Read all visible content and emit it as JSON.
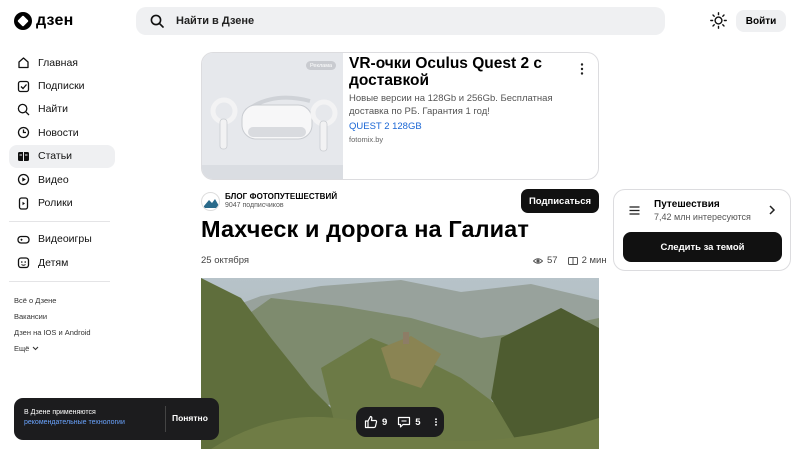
{
  "header": {
    "logo_text": "дзен",
    "search_placeholder": "Найти в Дзене",
    "login_label": "Войти"
  },
  "sidebar": {
    "items": [
      {
        "label": "Главная",
        "icon": "home-icon",
        "active": false
      },
      {
        "label": "Подписки",
        "icon": "subscriptions-icon",
        "active": false
      },
      {
        "label": "Найти",
        "icon": "search-icon",
        "active": false
      },
      {
        "label": "Новости",
        "icon": "news-icon",
        "active": false
      },
      {
        "label": "Статьи",
        "icon": "articles-icon",
        "active": true
      },
      {
        "label": "Видео",
        "icon": "video-icon",
        "active": false
      },
      {
        "label": "Ролики",
        "icon": "shorts-icon",
        "active": false
      }
    ],
    "items2": [
      {
        "label": "Видеоигры",
        "icon": "gamepad-icon"
      },
      {
        "label": "Детям",
        "icon": "kids-icon"
      }
    ],
    "footer_links": [
      "Всё о Дзене",
      "Вакансии",
      "Дзен на IOS и Android",
      "Ещё"
    ]
  },
  "ad": {
    "badge": "Реклама",
    "title": "VR-очки Oculus Quest 2 с доставкой",
    "text": "Новые версии на 128Gb и 256Gb. Бесплатная доставка по РБ. Гарантия 1 год!",
    "link": "QUEST 2 128GB",
    "domain": "fotomix.by"
  },
  "channel": {
    "name": "БЛОГ ФОТОПУТЕШЕСТВИЙ",
    "subscribers": "9047 подписчиков",
    "subscribe_label": "Подписаться"
  },
  "article": {
    "title": "Махческ и дорога на Галиат",
    "date": "25 октября",
    "views": "57",
    "read_time": "2 мин"
  },
  "topic": {
    "name": "Путешествия",
    "interested": "7,42 млн интересуются",
    "follow_label": "Следить за темой"
  },
  "toast": {
    "line1": "В Дзене применяются",
    "line2": "рекомендательные технологии",
    "ok_label": "Понятно"
  },
  "reactions": {
    "likes": "9",
    "comments": "5"
  }
}
